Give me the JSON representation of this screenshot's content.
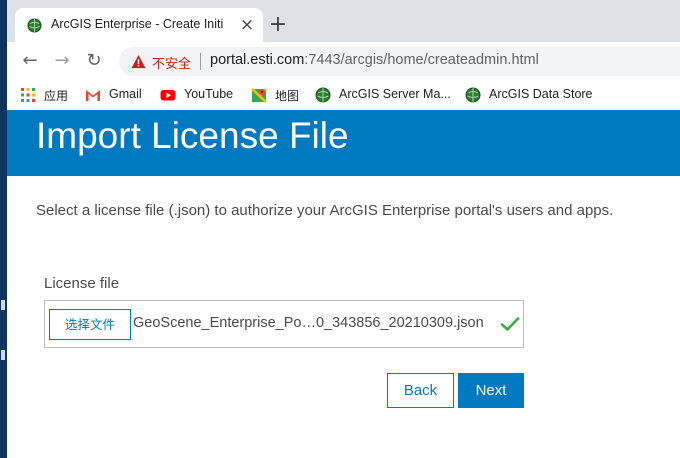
{
  "browser": {
    "tab": {
      "title": "ArcGIS Enterprise - Create Initi",
      "close_glyph": "×"
    },
    "new_tab_glyph": "+",
    "nav": {
      "back_glyph": "←",
      "forward_glyph": "→",
      "reload_glyph": "↻"
    },
    "address": {
      "security_label": "不安全",
      "url_host": "portal.esti.com",
      "url_rest": ":7443/arcgis/home/createadmin.html"
    },
    "bookmarks": [
      {
        "label": "应用",
        "icon": "apps-grid-icon"
      },
      {
        "label": "Gmail",
        "icon": "gmail-icon"
      },
      {
        "label": "YouTube",
        "icon": "youtube-icon"
      },
      {
        "label": "地图",
        "icon": "maps-icon"
      },
      {
        "label": "ArcGIS Server Ma...",
        "icon": "arcgis-globe-icon"
      },
      {
        "label": "ArcGIS Data Store",
        "icon": "arcgis-globe-icon"
      }
    ]
  },
  "page": {
    "title": "Import License File",
    "description": "Select a license file (.json) to authorize your ArcGIS Enterprise portal's users and apps.",
    "license_field": {
      "label": "License file",
      "choose_button": "选择文件",
      "file_name": "GeoScene_Enterprise_Po…0_343856_20210309.json",
      "status_icon": "checkmark-icon"
    },
    "buttons": {
      "back": "Back",
      "next": "Next"
    }
  },
  "colors": {
    "accent": "#0079c1",
    "check": "#35ac46",
    "insecure": "#c5221f",
    "desktop": "#0b2a4a"
  }
}
